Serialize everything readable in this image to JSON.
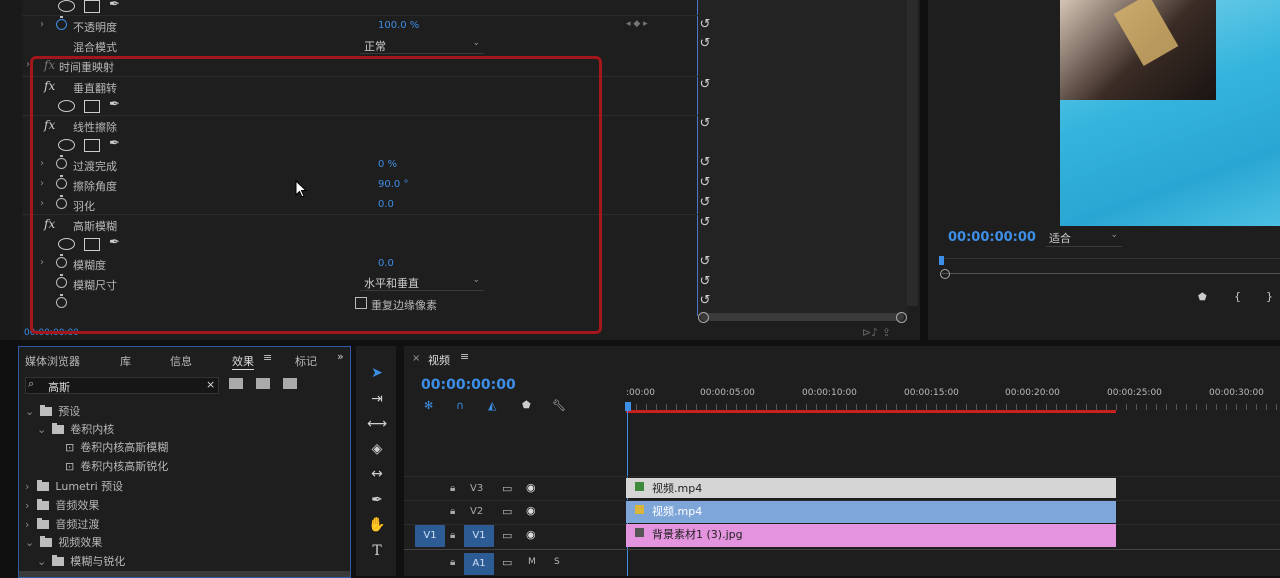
{
  "effect_controls": {
    "rows": [
      {
        "type": "shapes",
        "top": 0
      },
      {
        "type": "param",
        "label": "不透明度",
        "value": "100.0 %"
      },
      {
        "type": "dropdown",
        "label": "混合模式",
        "value": "正常"
      },
      {
        "type": "fx",
        "label": "时间重映射"
      },
      {
        "type": "fx",
        "label": "垂直翻转"
      },
      {
        "type": "fx",
        "label": "线性擦除"
      },
      {
        "type": "param",
        "label": "过渡完成",
        "value": "0 %"
      },
      {
        "type": "param",
        "label": "擦除角度",
        "value": "90.0 °"
      },
      {
        "type": "param",
        "label": "羽化",
        "value": "0.0"
      },
      {
        "type": "fx",
        "label": "高斯模糊"
      },
      {
        "type": "param",
        "label": "模糊度",
        "value": "0.0"
      },
      {
        "type": "dropdown",
        "label": "模糊尺寸",
        "value": "水平和垂直"
      },
      {
        "type": "checkbox",
        "label": "重复边缘像素"
      }
    ],
    "opacity_label": "不透明度",
    "opacity_value": "100.0 %",
    "blend_label": "混合模式",
    "blend_value": "正常",
    "time_remap_label": "时间重映射",
    "vflip_label": "垂直翻转",
    "linear_wipe_label": "线性擦除",
    "transition_label": "过渡完成",
    "transition_value": "0 %",
    "wipe_angle_label": "擦除角度",
    "wipe_angle_value": "90.0 °",
    "feather_label": "羽化",
    "feather_value": "0.0",
    "gaussian_label": "高斯模糊",
    "blurriness_label": "模糊度",
    "blurriness_value": "0.0",
    "blur_dim_label": "模糊尺寸",
    "blur_dim_value": "水平和垂直",
    "repeat_edge_label": "重复边缘像素",
    "timecode": "00:00:00:00",
    "highlight_color": "#a3161b"
  },
  "program_monitor": {
    "timecode": "00:00:00:00",
    "fit_value": "适合"
  },
  "effects_panel": {
    "tabs": [
      "媒体浏览器",
      "库",
      "信息",
      "效果",
      "标记"
    ],
    "active_tab": "效果",
    "search_value": "高斯",
    "tree": {
      "presets": "预设",
      "convolution": "卷积内核",
      "conv_blur": "卷积内核高斯模糊",
      "conv_sharpen": "卷积内核高斯锐化",
      "lumetri": "Lumetri 预设",
      "audio_effects": "音频效果",
      "audio_transitions": "音频过渡",
      "video_effects": "视频效果",
      "blur_sharpen": "模糊与锐化"
    }
  },
  "timeline": {
    "tab_label": "视频",
    "timecode": "00:00:00:00",
    "ruler": [
      ":00:00",
      "00:00:05:00",
      "00:00:10:00",
      "00:00:15:00",
      "00:00:20:00",
      "00:00:25:00",
      "00:00:30:00"
    ],
    "tracks": {
      "v3": "V3",
      "v2": "V2",
      "v1_source": "V1",
      "v1": "V1",
      "a1": "A1",
      "mute": "M",
      "solo": "S"
    },
    "clips": {
      "v3": "视频.mp4",
      "v2": "视频.mp4",
      "v1": "背景素材1 (3).jpg"
    },
    "colors": {
      "clip_v3": "#d5d5d5",
      "clip_v2": "#7ea6d8",
      "clip_v1": "#e493de",
      "work_area": "#c8201e",
      "accent": "#3d8ee6"
    }
  }
}
